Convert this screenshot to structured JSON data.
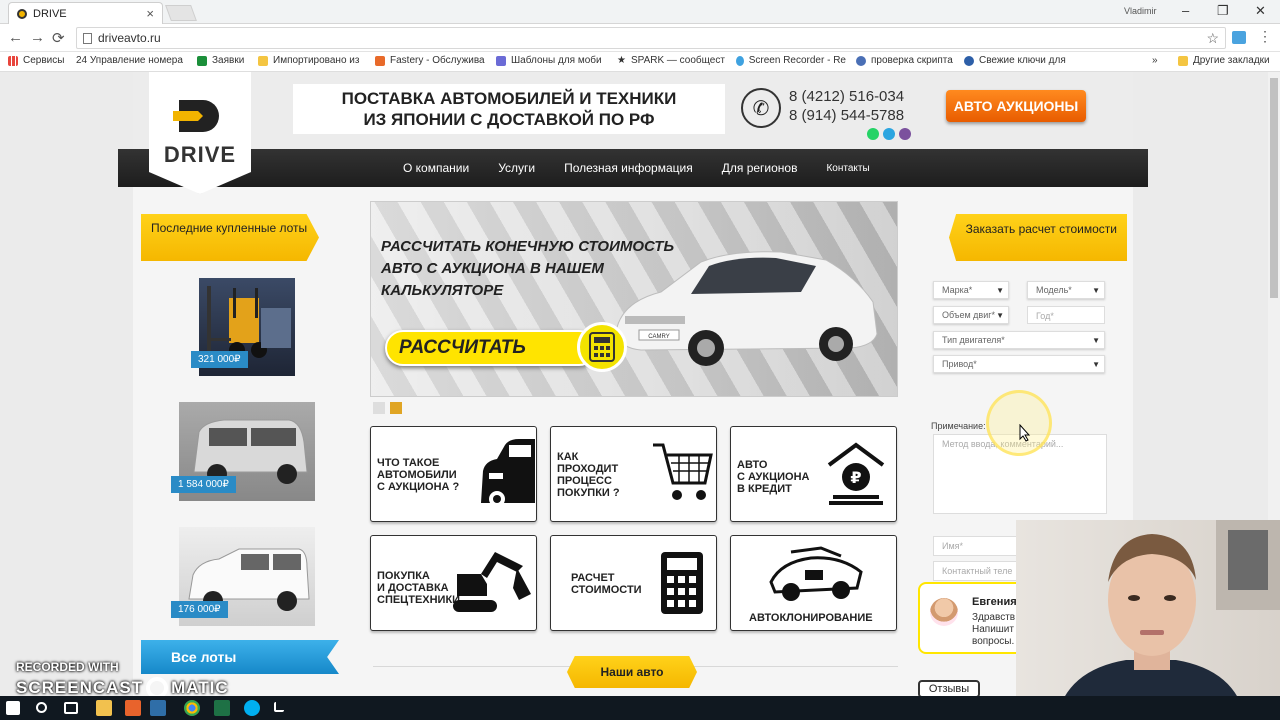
{
  "browser": {
    "tab_title": "DRIVE",
    "tab_close": "×",
    "user": "Vladimir",
    "window_controls": [
      "–",
      "❐",
      "✕"
    ],
    "nav": [
      "←",
      "→",
      "⟳"
    ],
    "url": "driveavto.ru",
    "star": "☆",
    "bookmarks": [
      {
        "label": "Сервисы",
        "color": "#e8453c"
      },
      {
        "label": "24  Управление номера",
        "color": "#1e5bb8"
      },
      {
        "label": "Заявки",
        "color": "#1b8f3a"
      },
      {
        "label": "Импортировано из",
        "color": "#f4c542"
      },
      {
        "label": "Fastery - Обслужива",
        "color": "#e86a2a"
      },
      {
        "label": "Шаблоны для моби",
        "color": "#6b6bd6"
      },
      {
        "label": "SPARK — сообщест",
        "color": "#222222"
      },
      {
        "label": "Screen Recorder - Re",
        "color": "#3fa2e0"
      },
      {
        "label": "проверка скрипта",
        "color": "#4a6fb5"
      },
      {
        "label": "Свежие ключи для",
        "color": "#2d5fa8"
      }
    ],
    "bookmarks_more": "»",
    "bookmarks_other": "Другие закладки"
  },
  "header": {
    "logo_text": "DRIVE",
    "tagline_line1": "ПОСТАВКА АВТОМОБИЛЕЙ И ТЕХНИКИ",
    "tagline_line2": "ИЗ  ЯПОНИИ  С ДОСТАВКОЙ ПО РФ",
    "phone1": "8 (4212) 516-034",
    "phone2": "8 (914) 544-5788",
    "auction_button": "АВТО АУКЦИОНЫ"
  },
  "nav": {
    "items": [
      "О компании",
      "Услуги",
      "Полезная информация",
      "Для регионов",
      "Контакты"
    ]
  },
  "left": {
    "heading": "Последние купленные лоты",
    "lots": [
      {
        "price": "321 000₽",
        "kind": "forklift"
      },
      {
        "price": "1 584 000₽",
        "kind": "minivan"
      },
      {
        "price": "176 000₽",
        "kind": "wagon"
      }
    ],
    "all_lots": "Все лоты"
  },
  "banner": {
    "title_line1": "РАССЧИТАТЬ КОНЕЧНУЮ СТОИМОСТЬ",
    "title_line2": "АВТО С АУКЦИОНА В НАШЕМ",
    "title_line3": "КАЛЬКУЛЯТОРЕ",
    "button": "РАССЧИТАТЬ",
    "plate": "CAMRY"
  },
  "tiles": [
    {
      "label": "ЧТО ТАКОЕ\nАВТОМОБИЛИ\nС АУКЦИОНА ?",
      "icon": "car-icon"
    },
    {
      "label": "КАК\nПРОХОДИТ\nПРОЦЕСС\nПОКУПКИ ?",
      "icon": "cart-icon"
    },
    {
      "label": "АВТО\nС АУКЦИОНА\nВ КРЕДИТ",
      "icon": "ruble-house-icon"
    },
    {
      "label": "ПОКУПКА\nИ ДОСТАВКА\nСПЕЦТЕХНИКИ",
      "icon": "excavator-icon"
    },
    {
      "label": "РАСЧЕТ\nСТОИМОСТИ",
      "icon": "calculator-icon"
    },
    {
      "label": "АВТОКЛОНИРОВАНИЕ",
      "icon": "car-parts-icon"
    }
  ],
  "our_cars": "Наши авто",
  "form": {
    "heading": "Заказать расчет стоимости",
    "brand": "Марка*",
    "model": "Модель*",
    "volume": "Объем двиг*",
    "year": "Год*",
    "engine_type": "Тип двигателя*",
    "drive": "Привод*",
    "note_label": "Примечание:",
    "note_placeholder": "Метод ввода, комментарий...",
    "name_placeholder": "Имя*",
    "phone_placeholder": "Контактный теле"
  },
  "chat": {
    "name": "Евгения",
    "text_line1": "Здравств",
    "text_line2": "Напишит",
    "text_line3": "вопросы."
  },
  "reviews": "Отзывы",
  "watermark": {
    "line1": "RECORDED WITH",
    "line2a": "SCREENCAST",
    "line2b": "MATIC"
  }
}
